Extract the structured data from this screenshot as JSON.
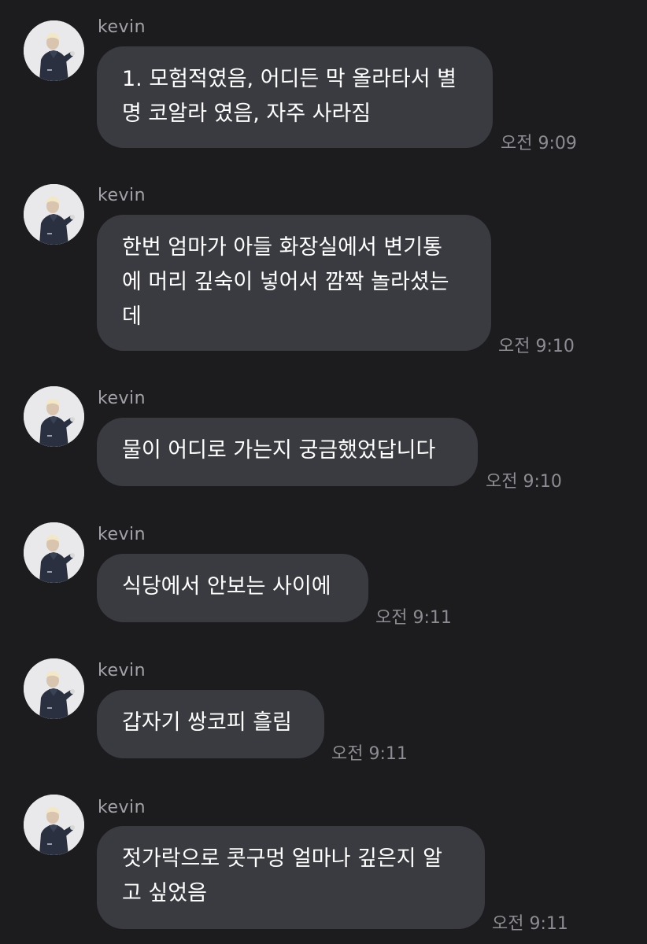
{
  "messages": [
    {
      "sender": "kevin",
      "text": "1. 모험적였음, 어디든 막 올라타서 별\n명 코알라 였음, 자주 사라짐",
      "time": "오전 9:09"
    },
    {
      "sender": "kevin",
      "text": "한번 엄마가 아들 화장실에서 변기통\n에 머리 깊숙이 넣어서 깜짝 놀라셨는\n데",
      "time": "오전 9:10"
    },
    {
      "sender": "kevin",
      "text": "물이 어디로 가는지 궁금했었답니다",
      "time": "오전 9:10"
    },
    {
      "sender": "kevin",
      "text": "식당에서 안보는 사이에",
      "time": "오전 9:11"
    },
    {
      "sender": "kevin",
      "text": "갑자기 쌍코피 흘림",
      "time": "오전 9:11"
    },
    {
      "sender": "kevin",
      "text": "젓가락으로 콧구멍 얼마나 깊은지 알\n고 싶었음",
      "time": "오전 9:11"
    }
  ],
  "colors": {
    "background": "#1c1c1e",
    "bubble": "#3a3b40",
    "message_text": "#ffffff",
    "sender_text": "#a2a2a8",
    "time_text": "#8c8c92",
    "avatar_bg": "#e9e9eb"
  },
  "icons": {
    "avatar": "profile-photo"
  }
}
